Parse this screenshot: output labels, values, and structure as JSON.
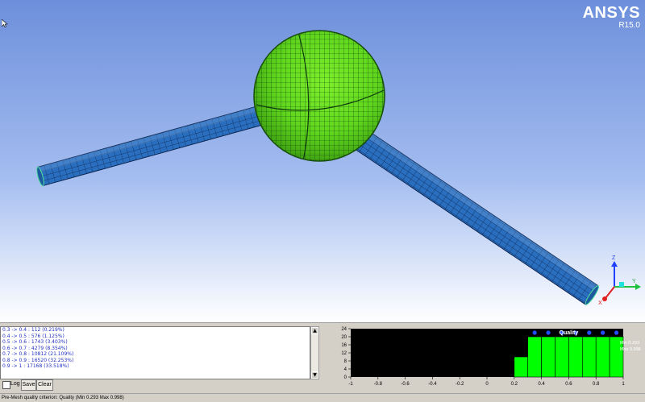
{
  "brand": {
    "name": "ANSYS",
    "version": "R15.0"
  },
  "log_lines": [
    "0.3 -> 0.4 : 112 (0.219%)",
    "0.4 -> 0.5 : 576 (1.125%)",
    "0.5 -> 0.6 : 1743 (3.403%)",
    "0.6 -> 0.7 : 4279 (8.354%)",
    "0.7 -> 0.8 : 10812 (21.109%)",
    "0.8 -> 0.9 : 16520 (32.253%)",
    "0.9 -> 1 : 17168 (33.518%)"
  ],
  "controls": {
    "log_label": "Log",
    "log_checked": false,
    "save_label": "Save",
    "clear_label": "Clear"
  },
  "axis_triad": {
    "z": "Z",
    "y": "Y",
    "x": "X"
  },
  "status": {
    "text": "Pre-Mesh quality criterion: Quality (Min 0.293 Max 0.998)"
  },
  "chart_data": {
    "type": "bar",
    "title": "Quality",
    "x_ticks": [
      "-1",
      "-0.8",
      "-0.6",
      "-0.4",
      "-0.2",
      "0",
      "0.2",
      "0.4",
      "0.6",
      "0.8",
      "1"
    ],
    "y_ticks": [
      "0",
      "4",
      "8",
      "12",
      "16",
      "20",
      "24"
    ],
    "xlim": [
      -1,
      1
    ],
    "ylim": [
      0,
      24
    ],
    "bins": [
      {
        "x0": 0.2,
        "x1": 0.3,
        "value": 10
      },
      {
        "x0": 0.3,
        "x1": 0.4,
        "value": 20
      },
      {
        "x0": 0.4,
        "x1": 0.5,
        "value": 20
      },
      {
        "x0": 0.5,
        "x1": 0.6,
        "value": 20
      },
      {
        "x0": 0.6,
        "x1": 0.7,
        "value": 20
      },
      {
        "x0": 0.7,
        "x1": 0.8,
        "value": 20
      },
      {
        "x0": 0.8,
        "x1": 0.9,
        "value": 20
      },
      {
        "x0": 0.9,
        "x1": 1.0,
        "value": 20
      }
    ],
    "markers": [
      0.35,
      0.45,
      0.55,
      0.65,
      0.75,
      0.85,
      0.95
    ],
    "min_label": "Min 0.293",
    "max_label": "Max 0.998",
    "colors": {
      "background": "#000000",
      "bar": "#00ff00",
      "marker": "#2050ff",
      "text": "#ffffff"
    }
  }
}
